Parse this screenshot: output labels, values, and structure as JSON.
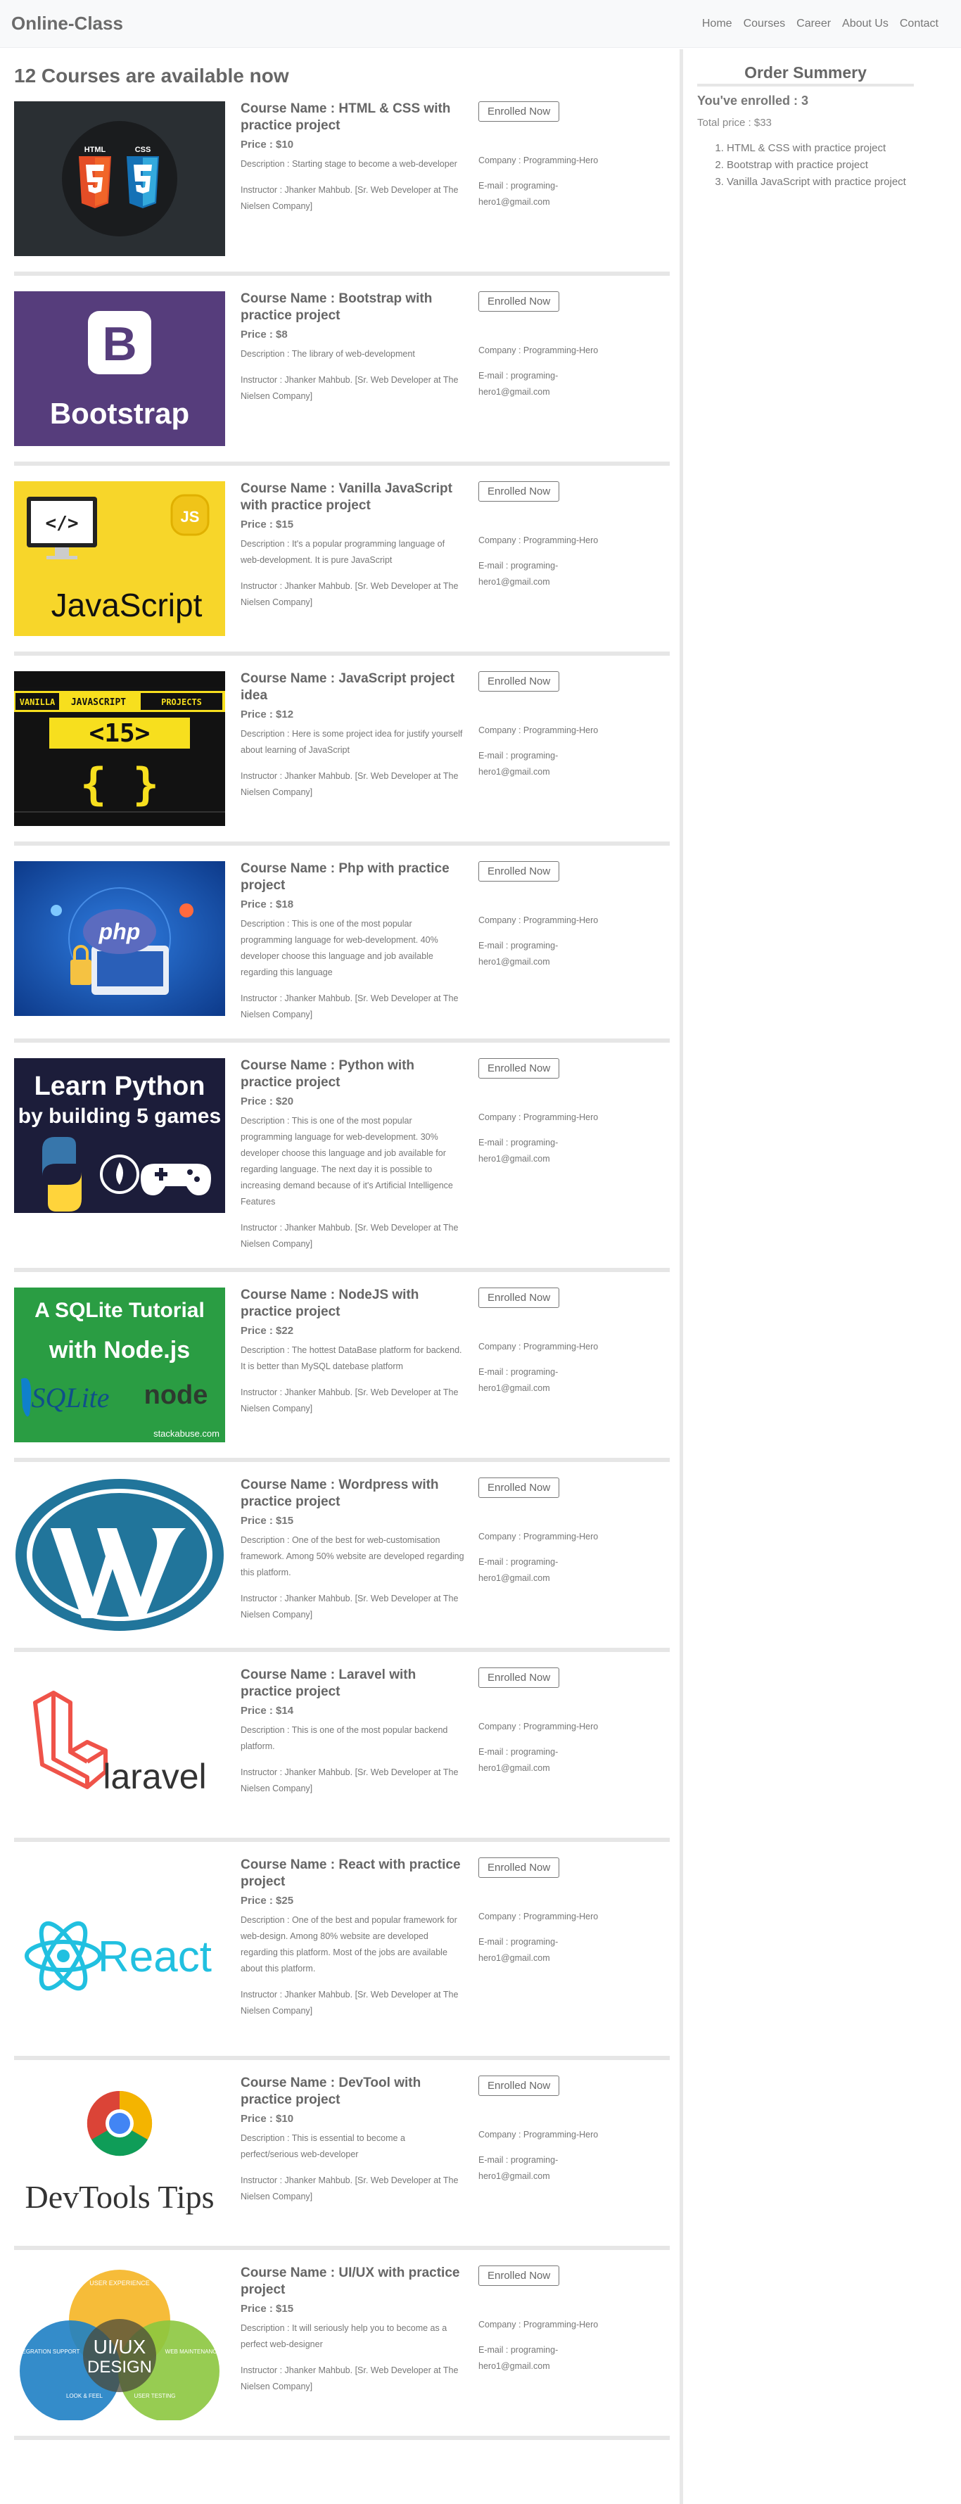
{
  "nav": {
    "brand": "Online-Class",
    "links": [
      "Home",
      "Courses",
      "Career",
      "About Us",
      "Contact"
    ]
  },
  "main": {
    "heading": "12 Courses are available now"
  },
  "courses": [
    {
      "name": "Course Name : HTML & CSS with practice project",
      "price": "Price : $10",
      "description": "Description : Starting stage to become a web-developer",
      "instructor": "Instructor : Jhanker Mahbub. [Sr. Web Developer at The Nielsen Company]",
      "button": "Enrolled Now",
      "company": "Company : Programming-Hero",
      "email": "E-mail : programing-hero1@gmail.com",
      "thumb_icon": "html-css-logo"
    },
    {
      "name": "Course Name : Bootstrap with practice project",
      "price": "Price : $8",
      "description": "Description : The library of web-development",
      "instructor": "Instructor : Jhanker Mahbub. [Sr. Web Developer at The Nielsen Company]",
      "button": "Enrolled Now",
      "company": "Company : Programming-Hero",
      "email": "E-mail : programing-hero1@gmail.com",
      "thumb_icon": "bootstrap-logo"
    },
    {
      "name": "Course Name : Vanilla JavaScript with practice project",
      "price": "Price : $15",
      "description": "Description : It's a popular programming language of web-development. It is pure JavaScript",
      "instructor": "Instructor : Jhanker Mahbub. [Sr. Web Developer at The Nielsen Company]",
      "button": "Enrolled Now",
      "company": "Company : Programming-Hero",
      "email": "E-mail : programing-hero1@gmail.com",
      "thumb_icon": "javascript-logo"
    },
    {
      "name": "Course Name : JavaScript project idea",
      "price": "Price : $12",
      "description": "Description : Here is some project idea for justify yourself about learning of JavaScript",
      "instructor": "Instructor : Jhanker Mahbub. [Sr. Web Developer at The Nielsen Company]",
      "button": "Enrolled Now",
      "company": "Company : Programming-Hero",
      "email": "E-mail : programing-hero1@gmail.com",
      "thumb_icon": "js-projects-logo"
    },
    {
      "name": "Course Name : Php with practice project",
      "price": "Price : $18",
      "description": "Description : This is one of the most popular programming language for web-development. 40% developer choose this language and job available regarding this language",
      "instructor": "Instructor : Jhanker Mahbub. [Sr. Web Developer at The Nielsen Company]",
      "button": "Enrolled Now",
      "company": "Company : Programming-Hero",
      "email": "E-mail : programing-hero1@gmail.com",
      "thumb_icon": "php-logo"
    },
    {
      "name": "Course Name : Python with practice project",
      "price": "Price : $20",
      "description": "Description : This is one of the most popular programming language for web-development. 30% developer choose this language and job available for regarding language. The next day it is possible to increasing demand because of it's Artificial Intelligence Features",
      "instructor": "Instructor : Jhanker Mahbub. [Sr. Web Developer at The Nielsen Company]",
      "button": "Enrolled Now",
      "company": "Company : Programming-Hero",
      "email": "E-mail : programing-hero1@gmail.com",
      "thumb_icon": "python-logo"
    },
    {
      "name": "Course Name : NodeJS with practice project",
      "price": "Price : $22",
      "description": "Description : The hottest DataBase platform for backend. It is better than MySQL datebase platform",
      "instructor": "Instructor : Jhanker Mahbub. [Sr. Web Developer at The Nielsen Company]",
      "button": "Enrolled Now",
      "company": "Company : Programming-Hero",
      "email": "E-mail : programing-hero1@gmail.com",
      "thumb_icon": "sqlite-node-logo"
    },
    {
      "name": "Course Name : Wordpress with practice project",
      "price": "Price : $15",
      "description": "Description : One of the best for web-customisation framework. Among 50% website are developed regarding this platform.",
      "instructor": "Instructor : Jhanker Mahbub. [Sr. Web Developer at The Nielsen Company]",
      "button": "Enrolled Now",
      "company": "Company : Programming-Hero",
      "email": "E-mail : programing-hero1@gmail.com",
      "thumb_icon": "wordpress-logo"
    },
    {
      "name": "Course Name : Laravel with practice project",
      "price": "Price : $14",
      "description": "Description : This is one of the most popular backend platform.",
      "instructor": "Instructor : Jhanker Mahbub. [Sr. Web Developer at The Nielsen Company]",
      "button": "Enrolled Now",
      "company": "Company : Programming-Hero",
      "email": "E-mail : programing-hero1@gmail.com",
      "thumb_icon": "laravel-logo"
    },
    {
      "name": "Course Name : React with practice project",
      "price": "Price : $25",
      "description": "Description : One of the best and popular framework for web-design. Among 80% website are developed regarding this platform. Most of the jobs are available about this platform.",
      "instructor": "Instructor : Jhanker Mahbub. [Sr. Web Developer at The Nielsen Company]",
      "button": "Enrolled Now",
      "company": "Company : Programming-Hero",
      "email": "E-mail : programing-hero1@gmail.com",
      "thumb_icon": "react-logo"
    },
    {
      "name": "Course Name : DevTool with practice project",
      "price": "Price : $10",
      "description": "Description : This is essential to become a perfect/serious web-developer",
      "instructor": "Instructor : Jhanker Mahbub. [Sr. Web Developer at The Nielsen Company]",
      "button": "Enrolled Now",
      "company": "Company : Programming-Hero",
      "email": "E-mail : programing-hero1@gmail.com",
      "thumb_icon": "devtools-logo"
    },
    {
      "name": "Course Name : UI/UX with practice project",
      "price": "Price : $15",
      "description": "Description : It will seriously help you to become as a perfect web-designer",
      "instructor": "Instructor : Jhanker Mahbub. [Sr. Web Developer at The Nielsen Company]",
      "button": "Enrolled Now",
      "company": "Company : Programming-Hero",
      "email": "E-mail : programing-hero1@gmail.com",
      "thumb_icon": "uiux-venn-logo"
    }
  ],
  "thumb_text": {
    "html": "HTML",
    "css": "CSS",
    "bootstrap": "Bootstrap",
    "bootstrap_b": "B",
    "js_code": "</>",
    "js_badge": "JS",
    "javascript": "JavaScript",
    "vanilla": "VANILLA",
    "js_word": "JAVASCRIPT",
    "projects": "PROJECTS",
    "fifteen": "<15>",
    "braces": "{ }",
    "php": "php",
    "py1": "Learn Python",
    "py2": "by building 5 games",
    "sqlite1": "A SQLite Tutorial",
    "sqlite2": "with Node.js",
    "sqlite3": "SQLite",
    "node": "node",
    "stackabuse": "stackabuse.com",
    "laravel": "laravel",
    "react": "React",
    "devtools": "DevTools Tips",
    "uiux1": "UI/UX",
    "uiux2": "DESIGN",
    "v_user": "USER EXPERIENCE",
    "v_integ": "INTEGRATION SUPPORT",
    "v_web": "WEB MAINTENANCE",
    "v_look": "LOOK & FEEL",
    "v_user2": "USER TESTING"
  },
  "sidebar": {
    "title": "Order Summery",
    "enrolled": "You've enrolled : 3",
    "total": "Total price : $33",
    "items": [
      "HTML & CSS with practice project",
      "Bootstrap with practice project",
      "Vanilla JavaScript with practice project"
    ]
  },
  "colors": {
    "bootstrap_purple": "#563d7c",
    "js_yellow": "#f7df1e",
    "php_blue": "#1a55b8",
    "python_navy": "#1b1d3a",
    "node_green": "#2b9a3c",
    "wordpress_blue": "#21759b",
    "laravel_red": "#ef5349",
    "react_cyan": "#21c0e0"
  }
}
